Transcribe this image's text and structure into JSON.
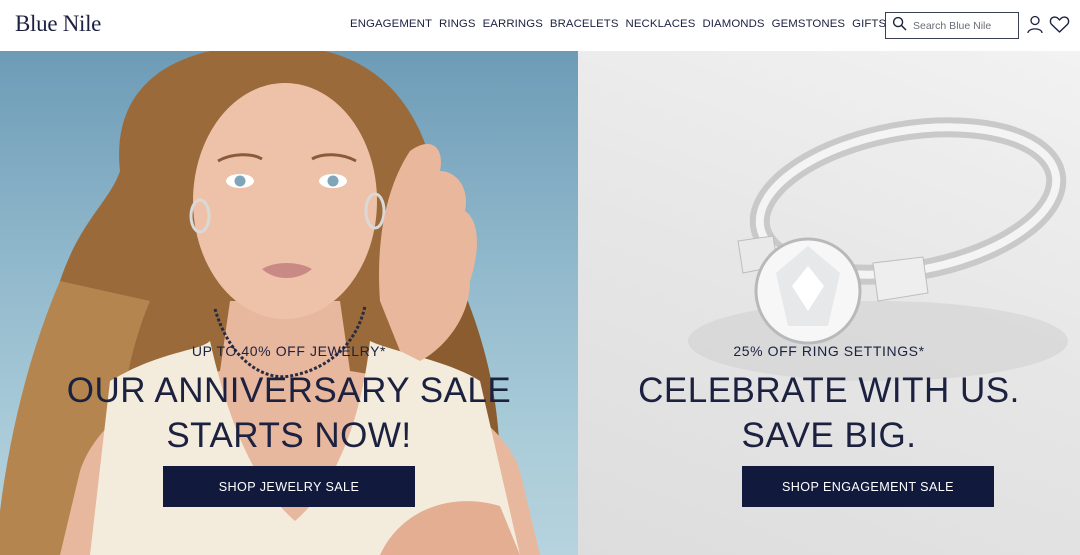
{
  "header": {
    "logo": "Blue Nile",
    "nav": [
      "ENGAGEMENT",
      "RINGS",
      "EARRINGS",
      "BRACELETS",
      "NECKLACES",
      "DIAMONDS",
      "GEMSTONES",
      "GIFTS"
    ],
    "search_placeholder": "Search Blue Nile",
    "icons": [
      "search-icon",
      "account-icon",
      "wishlist-heart-icon"
    ]
  },
  "hero_left": {
    "eyebrow": "UP TO 40% OFF JEWELRY*",
    "headline_line1": "OUR ANNIVERSARY SALE",
    "headline_line2": "STARTS NOW!",
    "cta": "SHOP JEWELRY SALE"
  },
  "hero_right": {
    "eyebrow": "25% OFF RING SETTINGS*",
    "headline_line1": "CELEBRATE WITH US.",
    "headline_line2": "SAVE BIG.",
    "cta": "SHOP ENGAGEMENT SALE"
  },
  "colors": {
    "navy": "#111a3c",
    "text_navy": "#1c2140"
  }
}
